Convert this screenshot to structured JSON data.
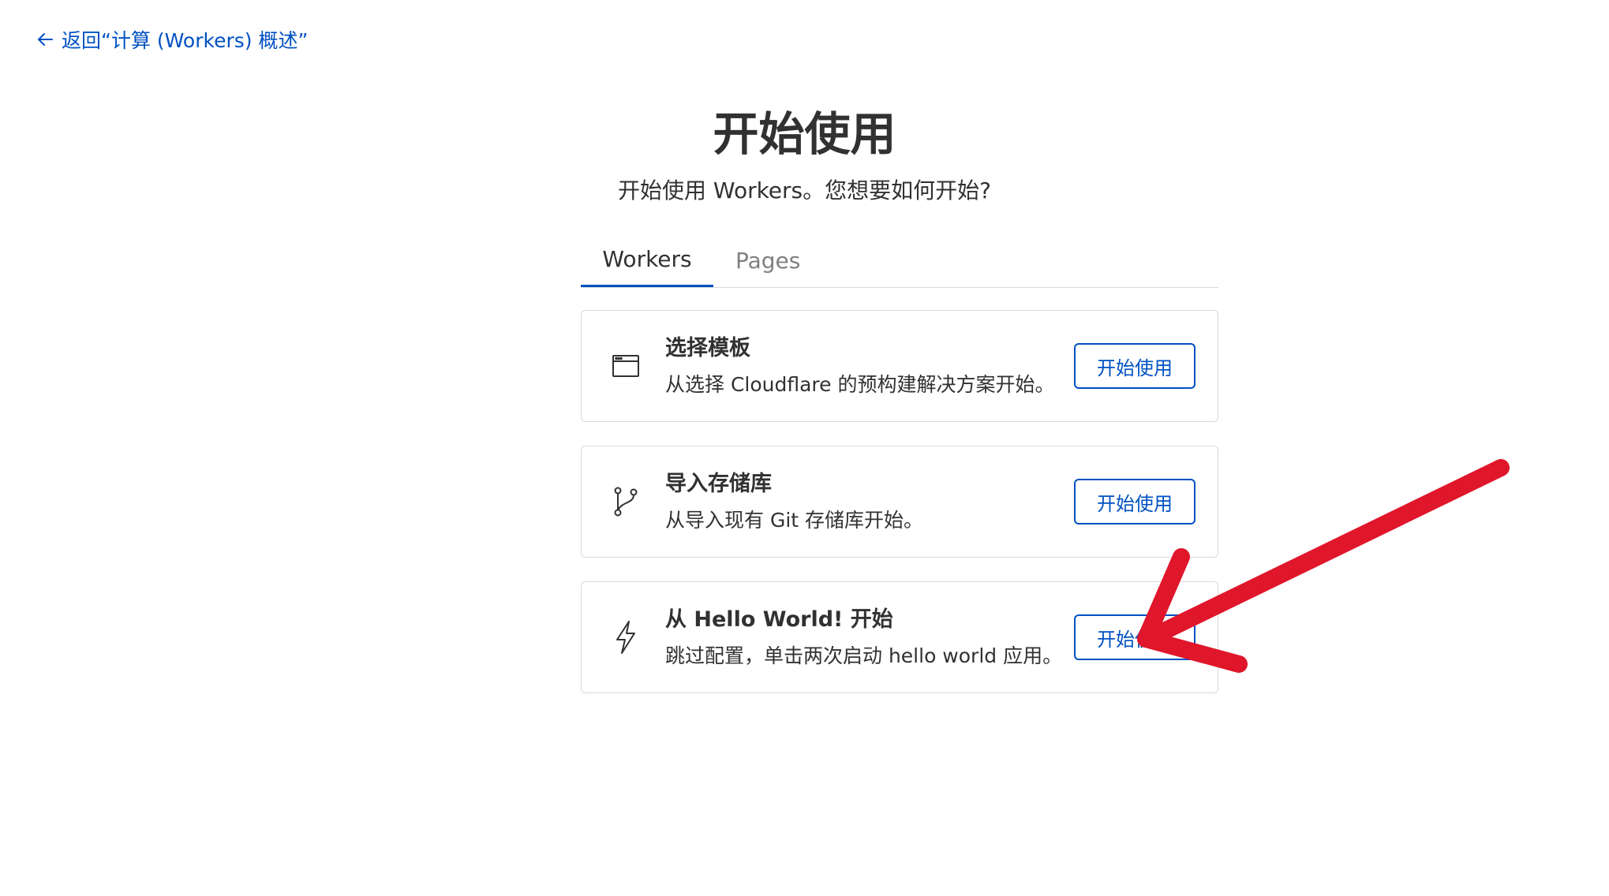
{
  "nav": {
    "back_label": "返回“计算 (Workers) 概述”",
    "back_icon": "arrow-left-icon"
  },
  "header": {
    "title": "开始使用",
    "subtitle": "开始使用 Workers。您想要如何开始?"
  },
  "tabs": [
    {
      "label": "Workers",
      "active": true
    },
    {
      "label": "Pages",
      "active": false
    }
  ],
  "cards": [
    {
      "icon": "browser-window-icon",
      "title": "选择模板",
      "description": "从选择 Cloudflare 的预构建解决方案开始。",
      "button_label": "开始使用"
    },
    {
      "icon": "git-branch-icon",
      "title": "导入存储库",
      "description": "从导入现有 Git 存储库开始。",
      "button_label": "开始使用"
    },
    {
      "icon": "lightning-bolt-icon",
      "title": "从 Hello World! 开始",
      "description": "跳过配置，单击两次启动 hello world 应用。",
      "button_label": "开始使用"
    }
  ],
  "annotation": {
    "type": "red-arrow",
    "color": "#e0162b"
  },
  "colors": {
    "accent": "#0051c3",
    "text": "#313131",
    "border": "#d9d9d9"
  }
}
